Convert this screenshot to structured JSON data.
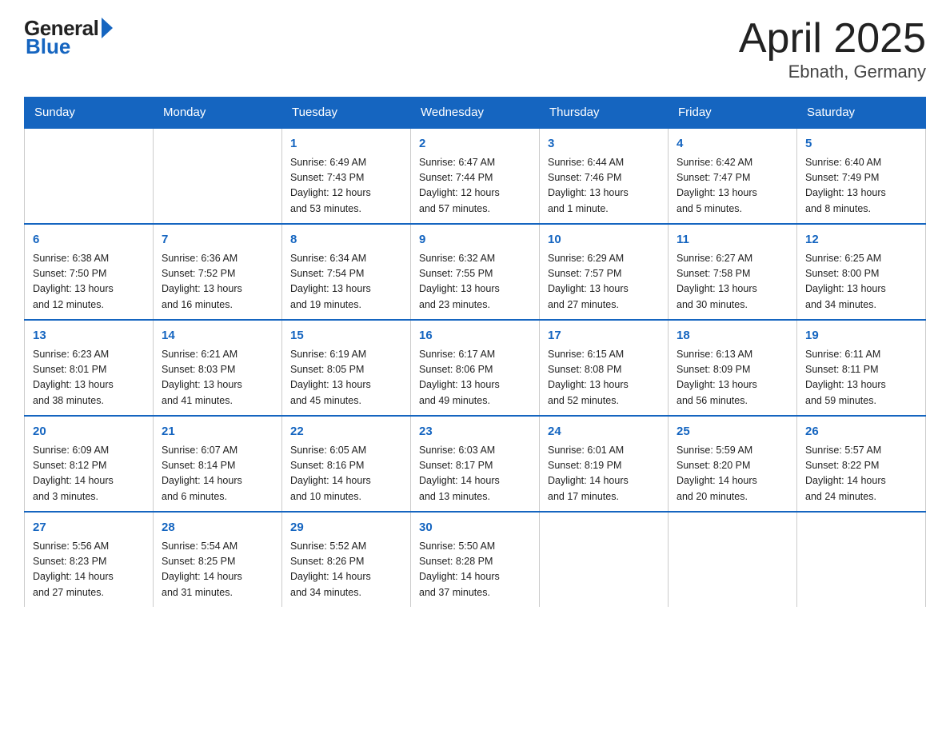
{
  "header": {
    "logo_general": "General",
    "logo_blue": "Blue",
    "title": "April 2025",
    "subtitle": "Ebnath, Germany"
  },
  "calendar": {
    "days_of_week": [
      "Sunday",
      "Monday",
      "Tuesday",
      "Wednesday",
      "Thursday",
      "Friday",
      "Saturday"
    ],
    "weeks": [
      [
        {
          "day": "",
          "info": ""
        },
        {
          "day": "",
          "info": ""
        },
        {
          "day": "1",
          "info": "Sunrise: 6:49 AM\nSunset: 7:43 PM\nDaylight: 12 hours\nand 53 minutes."
        },
        {
          "day": "2",
          "info": "Sunrise: 6:47 AM\nSunset: 7:44 PM\nDaylight: 12 hours\nand 57 minutes."
        },
        {
          "day": "3",
          "info": "Sunrise: 6:44 AM\nSunset: 7:46 PM\nDaylight: 13 hours\nand 1 minute."
        },
        {
          "day": "4",
          "info": "Sunrise: 6:42 AM\nSunset: 7:47 PM\nDaylight: 13 hours\nand 5 minutes."
        },
        {
          "day": "5",
          "info": "Sunrise: 6:40 AM\nSunset: 7:49 PM\nDaylight: 13 hours\nand 8 minutes."
        }
      ],
      [
        {
          "day": "6",
          "info": "Sunrise: 6:38 AM\nSunset: 7:50 PM\nDaylight: 13 hours\nand 12 minutes."
        },
        {
          "day": "7",
          "info": "Sunrise: 6:36 AM\nSunset: 7:52 PM\nDaylight: 13 hours\nand 16 minutes."
        },
        {
          "day": "8",
          "info": "Sunrise: 6:34 AM\nSunset: 7:54 PM\nDaylight: 13 hours\nand 19 minutes."
        },
        {
          "day": "9",
          "info": "Sunrise: 6:32 AM\nSunset: 7:55 PM\nDaylight: 13 hours\nand 23 minutes."
        },
        {
          "day": "10",
          "info": "Sunrise: 6:29 AM\nSunset: 7:57 PM\nDaylight: 13 hours\nand 27 minutes."
        },
        {
          "day": "11",
          "info": "Sunrise: 6:27 AM\nSunset: 7:58 PM\nDaylight: 13 hours\nand 30 minutes."
        },
        {
          "day": "12",
          "info": "Sunrise: 6:25 AM\nSunset: 8:00 PM\nDaylight: 13 hours\nand 34 minutes."
        }
      ],
      [
        {
          "day": "13",
          "info": "Sunrise: 6:23 AM\nSunset: 8:01 PM\nDaylight: 13 hours\nand 38 minutes."
        },
        {
          "day": "14",
          "info": "Sunrise: 6:21 AM\nSunset: 8:03 PM\nDaylight: 13 hours\nand 41 minutes."
        },
        {
          "day": "15",
          "info": "Sunrise: 6:19 AM\nSunset: 8:05 PM\nDaylight: 13 hours\nand 45 minutes."
        },
        {
          "day": "16",
          "info": "Sunrise: 6:17 AM\nSunset: 8:06 PM\nDaylight: 13 hours\nand 49 minutes."
        },
        {
          "day": "17",
          "info": "Sunrise: 6:15 AM\nSunset: 8:08 PM\nDaylight: 13 hours\nand 52 minutes."
        },
        {
          "day": "18",
          "info": "Sunrise: 6:13 AM\nSunset: 8:09 PM\nDaylight: 13 hours\nand 56 minutes."
        },
        {
          "day": "19",
          "info": "Sunrise: 6:11 AM\nSunset: 8:11 PM\nDaylight: 13 hours\nand 59 minutes."
        }
      ],
      [
        {
          "day": "20",
          "info": "Sunrise: 6:09 AM\nSunset: 8:12 PM\nDaylight: 14 hours\nand 3 minutes."
        },
        {
          "day": "21",
          "info": "Sunrise: 6:07 AM\nSunset: 8:14 PM\nDaylight: 14 hours\nand 6 minutes."
        },
        {
          "day": "22",
          "info": "Sunrise: 6:05 AM\nSunset: 8:16 PM\nDaylight: 14 hours\nand 10 minutes."
        },
        {
          "day": "23",
          "info": "Sunrise: 6:03 AM\nSunset: 8:17 PM\nDaylight: 14 hours\nand 13 minutes."
        },
        {
          "day": "24",
          "info": "Sunrise: 6:01 AM\nSunset: 8:19 PM\nDaylight: 14 hours\nand 17 minutes."
        },
        {
          "day": "25",
          "info": "Sunrise: 5:59 AM\nSunset: 8:20 PM\nDaylight: 14 hours\nand 20 minutes."
        },
        {
          "day": "26",
          "info": "Sunrise: 5:57 AM\nSunset: 8:22 PM\nDaylight: 14 hours\nand 24 minutes."
        }
      ],
      [
        {
          "day": "27",
          "info": "Sunrise: 5:56 AM\nSunset: 8:23 PM\nDaylight: 14 hours\nand 27 minutes."
        },
        {
          "day": "28",
          "info": "Sunrise: 5:54 AM\nSunset: 8:25 PM\nDaylight: 14 hours\nand 31 minutes."
        },
        {
          "day": "29",
          "info": "Sunrise: 5:52 AM\nSunset: 8:26 PM\nDaylight: 14 hours\nand 34 minutes."
        },
        {
          "day": "30",
          "info": "Sunrise: 5:50 AM\nSunset: 8:28 PM\nDaylight: 14 hours\nand 37 minutes."
        },
        {
          "day": "",
          "info": ""
        },
        {
          "day": "",
          "info": ""
        },
        {
          "day": "",
          "info": ""
        }
      ]
    ]
  }
}
